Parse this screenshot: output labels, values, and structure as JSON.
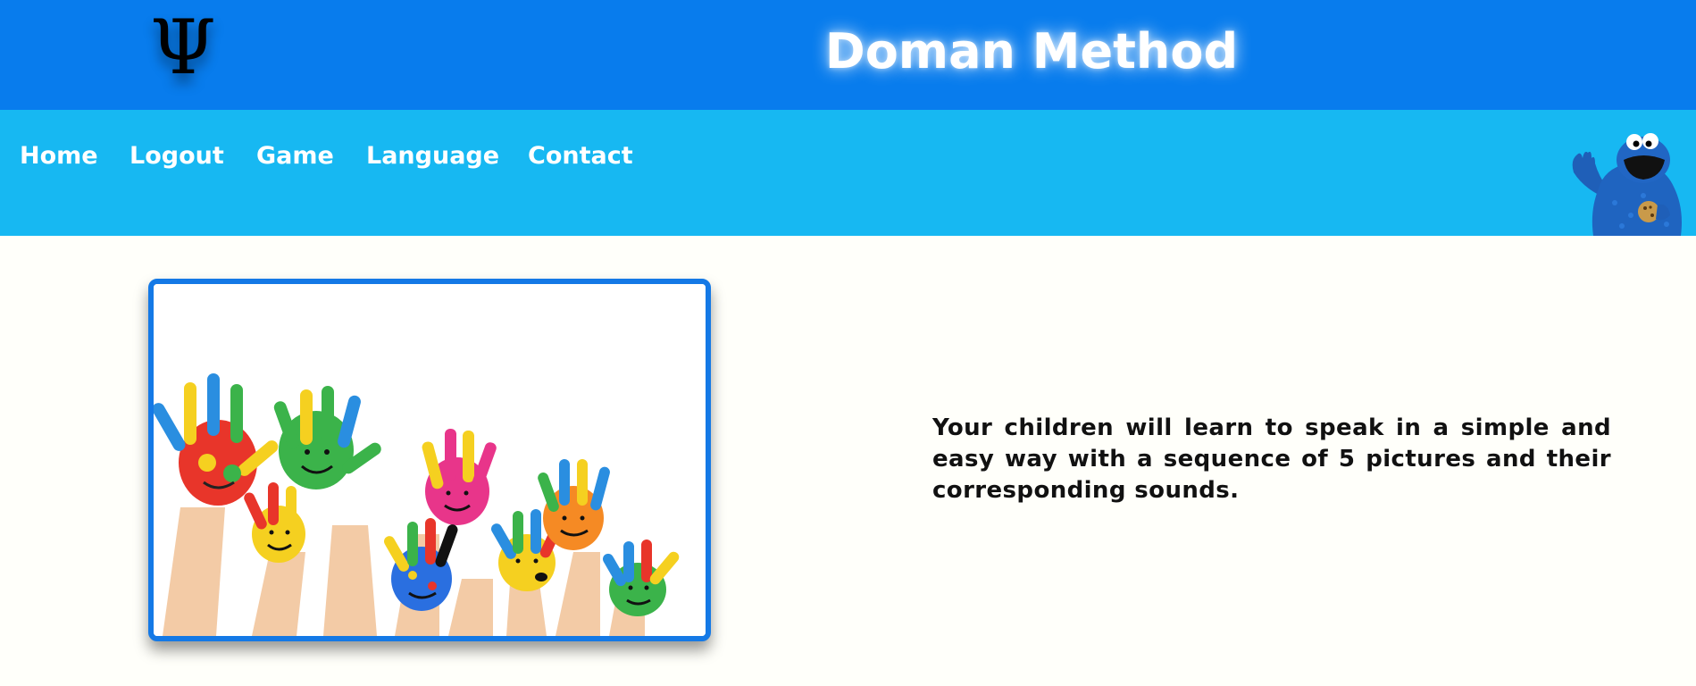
{
  "header": {
    "logo_glyph": "Ψ",
    "title": "Doman Method",
    "background_color": "#087ced"
  },
  "nav": {
    "background_color": "#17b8f2",
    "items": [
      {
        "label": "Home"
      },
      {
        "label": "Logout"
      },
      {
        "label": "Game"
      },
      {
        "label": "Language"
      },
      {
        "label": "Contact"
      }
    ],
    "mascot_icon": "cookie-monster-mascot"
  },
  "main": {
    "image_icon": "painted-hands-photo",
    "frame_color": "#1479e6",
    "intro_text": "Your children will learn to speak in a simple and easy way with a sequence of 5 pictures and their corresponding sounds."
  }
}
